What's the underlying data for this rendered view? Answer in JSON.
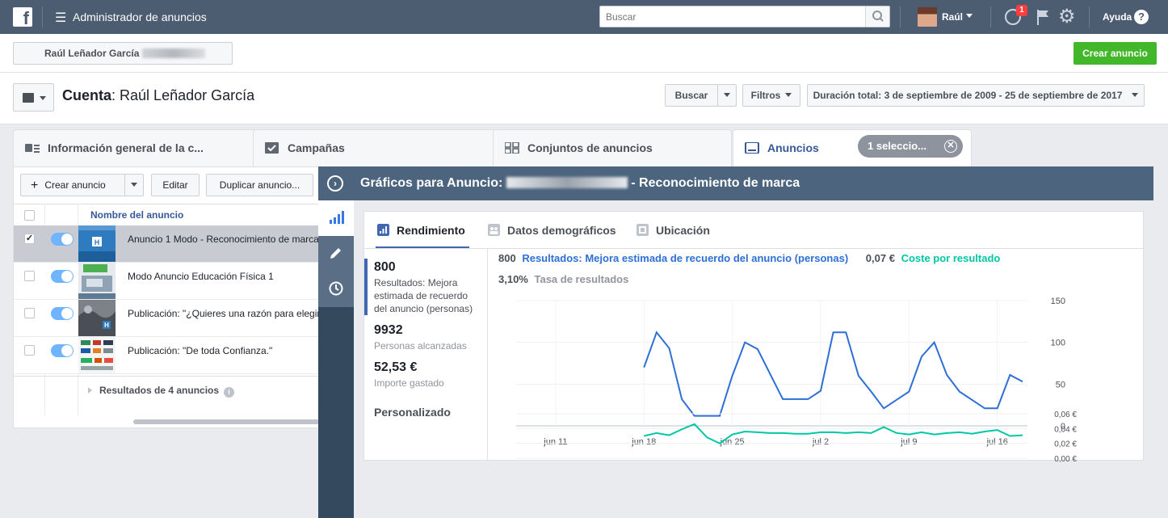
{
  "topbar": {
    "app_title": "Administrador de anuncios",
    "search_placeholder": "Buscar",
    "user_name": "Raúl",
    "notification_count": "1",
    "help_label": "Ayuda"
  },
  "account_strip": {
    "account_name": "Raúl Leñador García",
    "create_ad_label": "Crear anuncio"
  },
  "account_header": {
    "label": "Cuenta",
    "name": "Raúl Leñador García",
    "search_button": "Buscar",
    "filters_button": "Filtros",
    "duration_label": "Duración total: 3 de septiembre de 2009 - 25 de septiembre de 2017"
  },
  "tabs": [
    {
      "label": "Información general de la c...",
      "icon": "overview-icon"
    },
    {
      "label": "Campañas",
      "icon": "campaigns-icon"
    },
    {
      "label": "Conjuntos de anuncios",
      "icon": "adsets-icon"
    },
    {
      "label": "Anuncios",
      "icon": "ads-icon"
    }
  ],
  "selection_pill": "1 seleccio...",
  "table": {
    "toolbar": {
      "create": "Crear anuncio",
      "edit": "Editar",
      "duplicate": "Duplicar anuncio..."
    },
    "column_name": "Nombre del anuncio",
    "rows": [
      {
        "label": "Anuncio 1 Modo - Reconocimiento de marca",
        "selected": true
      },
      {
        "label": "Modo Anuncio Educación Física 1",
        "selected": false
      },
      {
        "label": "Publicación: \"¿Quieres una razón para elegir",
        "selected": false
      },
      {
        "label": "Publicación: \"De toda Confianza.\"",
        "selected": false
      }
    ],
    "results_label": "Resultados de 4 anuncios"
  },
  "graph_panel": {
    "title_prefix": "Gráficos para Anuncio:",
    "title_suffix": "- Reconocimiento de marca",
    "tabs": [
      "Rendimiento",
      "Datos demográficos",
      "Ubicación"
    ],
    "metrics": [
      {
        "value": "800",
        "label": "Resultados: Mejora estimada de recuerdo del anuncio (personas)"
      },
      {
        "value": "9932",
        "label": "Personas alcanzadas"
      },
      {
        "value": "52,53 €",
        "label": "Importe gastado"
      }
    ],
    "custom_label": "Personalizado",
    "legend": {
      "results_value": "800",
      "results_label": "Resultados: Mejora estimada de recuerdo del anuncio (personas)",
      "cost_value": "0,07 €",
      "cost_label": "Coste por resultado",
      "rate_value": "3,10%",
      "rate_label": "Tasa de resultados"
    }
  },
  "colors": {
    "results_line": "#2d6fd6",
    "cost_line": "#00c7a4",
    "accent_green": "#42b72a"
  },
  "chart_data": [
    {
      "type": "line",
      "x": [
        "jun 11",
        "jun 12",
        "jun 13",
        "jun 14",
        "jun 15",
        "jun 16",
        "jun 17",
        "jun 18",
        "jun 19",
        "jun 20",
        "jun 21",
        "jun 22",
        "jun 23",
        "jun 24",
        "jun 25",
        "jun 26",
        "jun 27",
        "jun 28",
        "jun 29",
        "jun 30",
        "jul 1",
        "jul 2",
        "jul 3",
        "jul 4",
        "jul 5",
        "jul 6",
        "jul 7",
        "jul 8",
        "jul 9",
        "jul 10",
        "jul 11",
        "jul 12",
        "jul 13",
        "jul 14",
        "jul 15",
        "jul 16",
        "jul 17"
      ],
      "series": [
        {
          "name": "Resultados: Mejora estimada de recuerdo del anuncio (personas)",
          "values": [
            null,
            null,
            null,
            null,
            null,
            null,
            null,
            null,
            null,
            null,
            70,
            112,
            93,
            32,
            12,
            12,
            12,
            60,
            100,
            92,
            62,
            32,
            32,
            32,
            42,
            112,
            112,
            60,
            41,
            21,
            31,
            41,
            83,
            100,
            61,
            41,
            31,
            21,
            21,
            61,
            53
          ]
        }
      ],
      "x_ticks": [
        "jun 11",
        "jun 18",
        "jun 25",
        "jul 2",
        "jul 9",
        "jul 16"
      ],
      "y_ticks": [
        "150",
        "100",
        "50",
        "0"
      ],
      "ylim": [
        0,
        150
      ]
    },
    {
      "type": "line",
      "x": [
        "jun 11",
        "jun 18",
        "jun 25",
        "jul 2",
        "jul 9",
        "jul 16"
      ],
      "series": [
        {
          "name": "Coste por resultado",
          "values": [
            0.03,
            0.034,
            0.031,
            0.039,
            0.046,
            0.028,
            0.02,
            0.032,
            0.036,
            0.035,
            0.034,
            0.034,
            0.033,
            0.033,
            0.035,
            0.035,
            0.034,
            0.035,
            0.034,
            0.042,
            0.034,
            0.032,
            0.035,
            0.032,
            0.034,
            0.035,
            0.033,
            0.036,
            0.038,
            0.03,
            0.031
          ]
        }
      ],
      "y_ticks": [
        "0,06 €",
        "0,04 €",
        "0,02 €",
        "0,00 €"
      ],
      "ylim": [
        0,
        0.06
      ]
    }
  ]
}
